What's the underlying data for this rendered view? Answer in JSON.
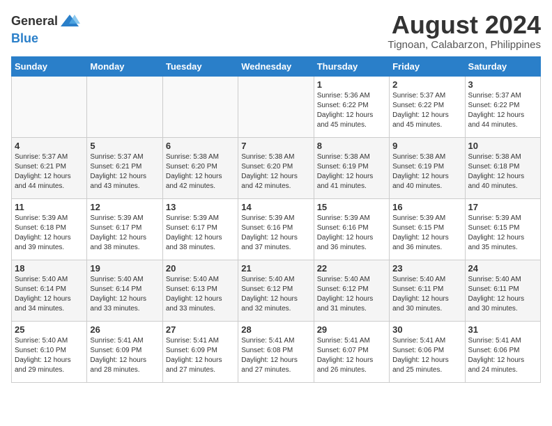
{
  "logo": {
    "text_general": "General",
    "text_blue": "Blue"
  },
  "header": {
    "title": "August 2024",
    "subtitle": "Tignoan, Calabarzon, Philippines"
  },
  "weekdays": [
    "Sunday",
    "Monday",
    "Tuesday",
    "Wednesday",
    "Thursday",
    "Friday",
    "Saturday"
  ],
  "weeks": [
    [
      {
        "day": "",
        "info": ""
      },
      {
        "day": "",
        "info": ""
      },
      {
        "day": "",
        "info": ""
      },
      {
        "day": "",
        "info": ""
      },
      {
        "day": "1",
        "info": "Sunrise: 5:36 AM\nSunset: 6:22 PM\nDaylight: 12 hours\nand 45 minutes."
      },
      {
        "day": "2",
        "info": "Sunrise: 5:37 AM\nSunset: 6:22 PM\nDaylight: 12 hours\nand 45 minutes."
      },
      {
        "day": "3",
        "info": "Sunrise: 5:37 AM\nSunset: 6:22 PM\nDaylight: 12 hours\nand 44 minutes."
      }
    ],
    [
      {
        "day": "4",
        "info": "Sunrise: 5:37 AM\nSunset: 6:21 PM\nDaylight: 12 hours\nand 44 minutes."
      },
      {
        "day": "5",
        "info": "Sunrise: 5:37 AM\nSunset: 6:21 PM\nDaylight: 12 hours\nand 43 minutes."
      },
      {
        "day": "6",
        "info": "Sunrise: 5:38 AM\nSunset: 6:20 PM\nDaylight: 12 hours\nand 42 minutes."
      },
      {
        "day": "7",
        "info": "Sunrise: 5:38 AM\nSunset: 6:20 PM\nDaylight: 12 hours\nand 42 minutes."
      },
      {
        "day": "8",
        "info": "Sunrise: 5:38 AM\nSunset: 6:19 PM\nDaylight: 12 hours\nand 41 minutes."
      },
      {
        "day": "9",
        "info": "Sunrise: 5:38 AM\nSunset: 6:19 PM\nDaylight: 12 hours\nand 40 minutes."
      },
      {
        "day": "10",
        "info": "Sunrise: 5:38 AM\nSunset: 6:18 PM\nDaylight: 12 hours\nand 40 minutes."
      }
    ],
    [
      {
        "day": "11",
        "info": "Sunrise: 5:39 AM\nSunset: 6:18 PM\nDaylight: 12 hours\nand 39 minutes."
      },
      {
        "day": "12",
        "info": "Sunrise: 5:39 AM\nSunset: 6:17 PM\nDaylight: 12 hours\nand 38 minutes."
      },
      {
        "day": "13",
        "info": "Sunrise: 5:39 AM\nSunset: 6:17 PM\nDaylight: 12 hours\nand 38 minutes."
      },
      {
        "day": "14",
        "info": "Sunrise: 5:39 AM\nSunset: 6:16 PM\nDaylight: 12 hours\nand 37 minutes."
      },
      {
        "day": "15",
        "info": "Sunrise: 5:39 AM\nSunset: 6:16 PM\nDaylight: 12 hours\nand 36 minutes."
      },
      {
        "day": "16",
        "info": "Sunrise: 5:39 AM\nSunset: 6:15 PM\nDaylight: 12 hours\nand 36 minutes."
      },
      {
        "day": "17",
        "info": "Sunrise: 5:39 AM\nSunset: 6:15 PM\nDaylight: 12 hours\nand 35 minutes."
      }
    ],
    [
      {
        "day": "18",
        "info": "Sunrise: 5:40 AM\nSunset: 6:14 PM\nDaylight: 12 hours\nand 34 minutes."
      },
      {
        "day": "19",
        "info": "Sunrise: 5:40 AM\nSunset: 6:14 PM\nDaylight: 12 hours\nand 33 minutes."
      },
      {
        "day": "20",
        "info": "Sunrise: 5:40 AM\nSunset: 6:13 PM\nDaylight: 12 hours\nand 33 minutes."
      },
      {
        "day": "21",
        "info": "Sunrise: 5:40 AM\nSunset: 6:12 PM\nDaylight: 12 hours\nand 32 minutes."
      },
      {
        "day": "22",
        "info": "Sunrise: 5:40 AM\nSunset: 6:12 PM\nDaylight: 12 hours\nand 31 minutes."
      },
      {
        "day": "23",
        "info": "Sunrise: 5:40 AM\nSunset: 6:11 PM\nDaylight: 12 hours\nand 30 minutes."
      },
      {
        "day": "24",
        "info": "Sunrise: 5:40 AM\nSunset: 6:11 PM\nDaylight: 12 hours\nand 30 minutes."
      }
    ],
    [
      {
        "day": "25",
        "info": "Sunrise: 5:40 AM\nSunset: 6:10 PM\nDaylight: 12 hours\nand 29 minutes."
      },
      {
        "day": "26",
        "info": "Sunrise: 5:41 AM\nSunset: 6:09 PM\nDaylight: 12 hours\nand 28 minutes."
      },
      {
        "day": "27",
        "info": "Sunrise: 5:41 AM\nSunset: 6:09 PM\nDaylight: 12 hours\nand 27 minutes."
      },
      {
        "day": "28",
        "info": "Sunrise: 5:41 AM\nSunset: 6:08 PM\nDaylight: 12 hours\nand 27 minutes."
      },
      {
        "day": "29",
        "info": "Sunrise: 5:41 AM\nSunset: 6:07 PM\nDaylight: 12 hours\nand 26 minutes."
      },
      {
        "day": "30",
        "info": "Sunrise: 5:41 AM\nSunset: 6:06 PM\nDaylight: 12 hours\nand 25 minutes."
      },
      {
        "day": "31",
        "info": "Sunrise: 5:41 AM\nSunset: 6:06 PM\nDaylight: 12 hours\nand 24 minutes."
      }
    ]
  ]
}
